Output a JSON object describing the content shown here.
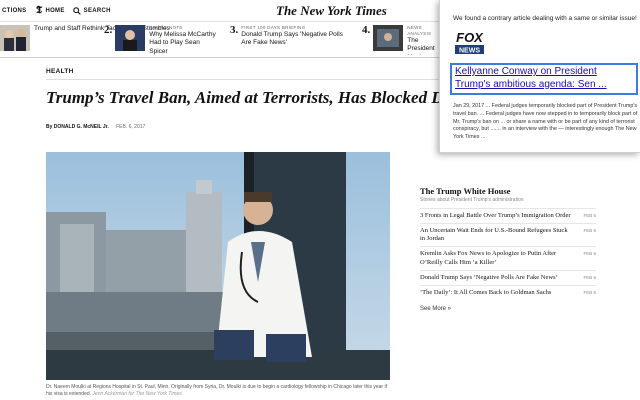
{
  "nav": {
    "section": "CTIONS",
    "home": "HOME",
    "search": "SEARCH",
    "logo": "The New York Times"
  },
  "ticker": [
    {
      "num": "",
      "label": "",
      "text": "Trump and Staff Rethink Tactics After Stumbles"
    },
    {
      "num": "2.",
      "label": "TAKING NOTE",
      "text": "Why Melissa McCarthy Had to Play Sean Spicer"
    },
    {
      "num": "3.",
      "label": "FIRST 100 DAYS BRIEFING",
      "text": "Donald Trump Says 'Negative Polls Are Fake News'"
    },
    {
      "num": "4.",
      "label": "NEWS ANALYSIS",
      "text": "The President Much Power"
    }
  ],
  "article": {
    "section": "HEALTH",
    "headline": "Trump’s Travel Ban, Aimed at Terrorists, Has Blocked Do",
    "author_prefix": "By",
    "author": "DONALD G. McNEIL Jr.",
    "date": "FEB. 6, 2017",
    "caption": "Dr. Naeem Moulki at Regions Hospital in St. Paul, Minn. Originally from Syria, Dr. Moulki is due to begin a cardiology fellowship in Chicago later this year if his visa is extended.",
    "credit": "Jenn Ackerman for The New York Times"
  },
  "sidebar": {
    "title": "The Trump White House",
    "subtitle": "Stories about President Trump's administration",
    "items": [
      {
        "text": "3 Fronts in Legal Battle Over Trump’s Immigration Order",
        "date": "FEB 6"
      },
      {
        "text": "An Uncertain Wait Ends for U.S.-Bound Refugees Stuck in Jordan",
        "date": "FEB 6"
      },
      {
        "text": "Kremlin Asks Fox News to Apologize to Putin After O’Reilly Calls Him ‘a Killer’",
        "date": "FEB 6"
      },
      {
        "text": "Donald Trump Says ‘Negative Polls Are Fake News’",
        "date": "FEB 6"
      },
      {
        "text": "‘The Daily’: It All Comes Back to Goldman Sachs",
        "date": "FEB 6"
      }
    ],
    "more": "See More »"
  },
  "popup": {
    "message": "We found a contrary article dealing with a same or similar issue!",
    "source_logo": "FOX NEWS",
    "link": "Kellyanne Conway on President Trump's ambitious agenda: Sen ...",
    "snippet": "Jan 29, 2017 ... Federal judges temporarily blocked part of President Trump's travel ban. ... Federal judges have now stepped in to temporarily block part of Mr. Trump's ban on ... or share a name with or be part of any kind of terrorist conspiracy, but ....... in an interview with the — interestingly enough The New York Times ..."
  },
  "colors": {
    "link": "#1a0dab",
    "link_border": "#3d7be0",
    "fox_blue": "#1d3e7a"
  }
}
